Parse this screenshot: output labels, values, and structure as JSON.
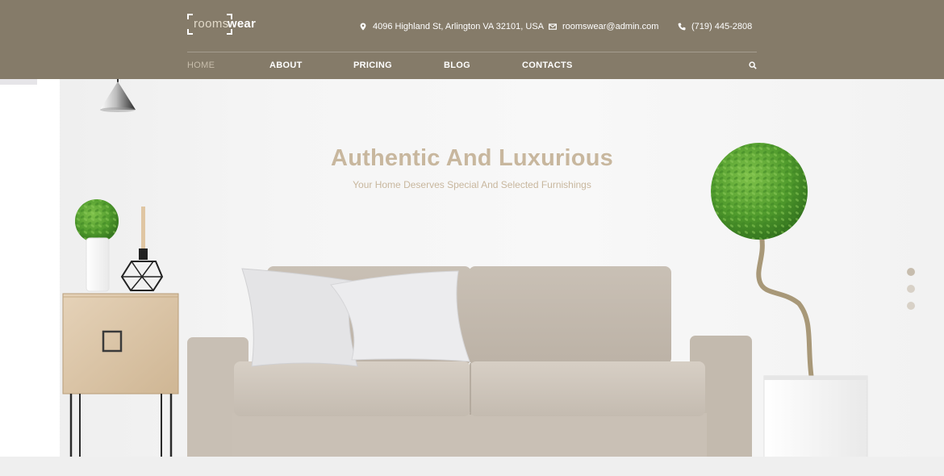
{
  "brand": {
    "logo_part1": "rooms",
    "logo_part2": "wear"
  },
  "contact": {
    "address": "4096 Highland St, Arlington VA 32101, USA",
    "email": "roomswear@admin.com",
    "phone": "(719) 445-2808"
  },
  "nav": {
    "items": [
      {
        "label": "HOME",
        "active": true
      },
      {
        "label": "ABOUT",
        "active": false
      },
      {
        "label": "PRICING",
        "active": false
      },
      {
        "label": "BLOG",
        "active": false
      },
      {
        "label": "CONTACTS",
        "active": false
      }
    ],
    "search_icon": "search-icon"
  },
  "hero": {
    "title": "Authentic And Luxurious",
    "subtitle": "Your Home Deserves Special And Selected Furnishings",
    "slide_count": 3,
    "active_slide": 1
  },
  "colors": {
    "header_bg": "#857b69",
    "accent_text": "#c8b79e",
    "nav_active": "#c7bdab"
  }
}
